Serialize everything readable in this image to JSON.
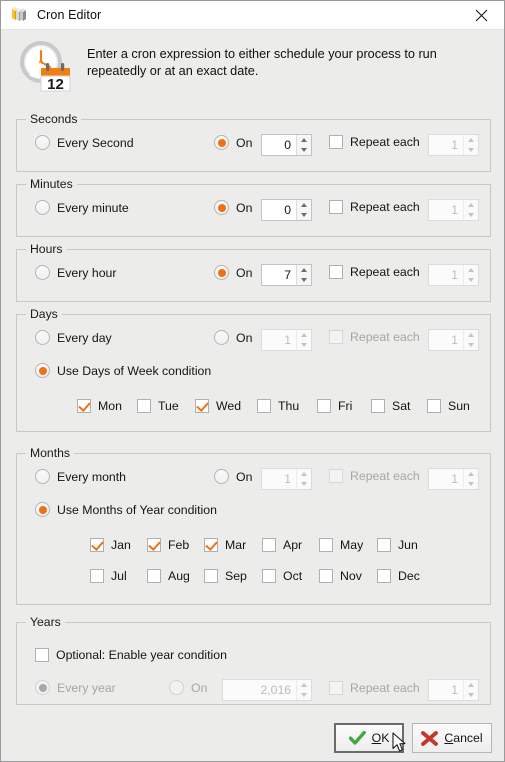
{
  "window": {
    "title": "Cron Editor",
    "icon": "stacked-books-icon",
    "close_label": "✕"
  },
  "header": {
    "icon": "clock-calendar-icon",
    "calendar_day": "12",
    "description": "Enter a cron expression to either schedule your process to run repeatedly or at an exact date."
  },
  "colors": {
    "accent": "#ef7015",
    "dialog_bg": "#ececeb",
    "group_border": "#c8c8c8",
    "ok_check": "#3fa93f",
    "cancel_x": "#c0392b"
  },
  "sections": {
    "seconds": {
      "title": "Seconds",
      "every_label": "Every Second",
      "every_selected": false,
      "on_label": "On",
      "on_selected": true,
      "on_value": "0",
      "repeat_label": "Repeat each",
      "repeat_checked": false,
      "repeat_value": "1",
      "disabled": false
    },
    "minutes": {
      "title": "Minutes",
      "every_label": "Every minute",
      "every_selected": false,
      "on_label": "On",
      "on_selected": true,
      "on_value": "0",
      "repeat_label": "Repeat each",
      "repeat_checked": false,
      "repeat_value": "1",
      "disabled": false
    },
    "hours": {
      "title": "Hours",
      "every_label": "Every hour",
      "every_selected": false,
      "on_label": "On",
      "on_selected": true,
      "on_value": "7",
      "repeat_label": "Repeat each",
      "repeat_checked": false,
      "repeat_value": "1",
      "disabled": false
    },
    "days": {
      "title": "Days",
      "every_label": "Every day",
      "every_selected": false,
      "on_label": "On",
      "on_selected": false,
      "on_value": "1",
      "repeat_label": "Repeat each",
      "repeat_checked": false,
      "repeat_value": "1",
      "condition_label": "Use Days of Week condition",
      "condition_selected": true,
      "weekdays": [
        {
          "label": "Mon",
          "checked": true
        },
        {
          "label": "Tue",
          "checked": false
        },
        {
          "label": "Wed",
          "checked": true
        },
        {
          "label": "Thu",
          "checked": false
        },
        {
          "label": "Fri",
          "checked": false
        },
        {
          "label": "Sat",
          "checked": false
        },
        {
          "label": "Sun",
          "checked": false
        }
      ]
    },
    "months": {
      "title": "Months",
      "every_label": "Every month",
      "every_selected": false,
      "on_label": "On",
      "on_selected": false,
      "on_value": "1",
      "repeat_label": "Repeat each",
      "repeat_checked": false,
      "repeat_value": "1",
      "condition_label": "Use Months of Year condition",
      "condition_selected": true,
      "months_row1": [
        {
          "label": "Jan",
          "checked": true
        },
        {
          "label": "Feb",
          "checked": true
        },
        {
          "label": "Mar",
          "checked": true
        },
        {
          "label": "Apr",
          "checked": false
        },
        {
          "label": "May",
          "checked": false
        },
        {
          "label": "Jun",
          "checked": false
        }
      ],
      "months_row2": [
        {
          "label": "Jul",
          "checked": false
        },
        {
          "label": "Aug",
          "checked": false
        },
        {
          "label": "Sep",
          "checked": false
        },
        {
          "label": "Oct",
          "checked": false
        },
        {
          "label": "Nov",
          "checked": false
        },
        {
          "label": "Dec",
          "checked": false
        }
      ]
    },
    "years": {
      "title": "Years",
      "enable_label": "Optional: Enable year condition",
      "enable_checked": false,
      "every_label": "Every year",
      "every_selected": true,
      "on_label": "On",
      "on_selected": false,
      "on_value": "2,016",
      "repeat_label": "Repeat each",
      "repeat_checked": false,
      "repeat_value": "1",
      "disabled": true
    }
  },
  "footer": {
    "ok_label": "OK",
    "ok_mnemonic": "O",
    "ok_rest": "K",
    "cancel_label": "Cancel",
    "cancel_mnemonic": "C",
    "cancel_rest": "ancel"
  }
}
